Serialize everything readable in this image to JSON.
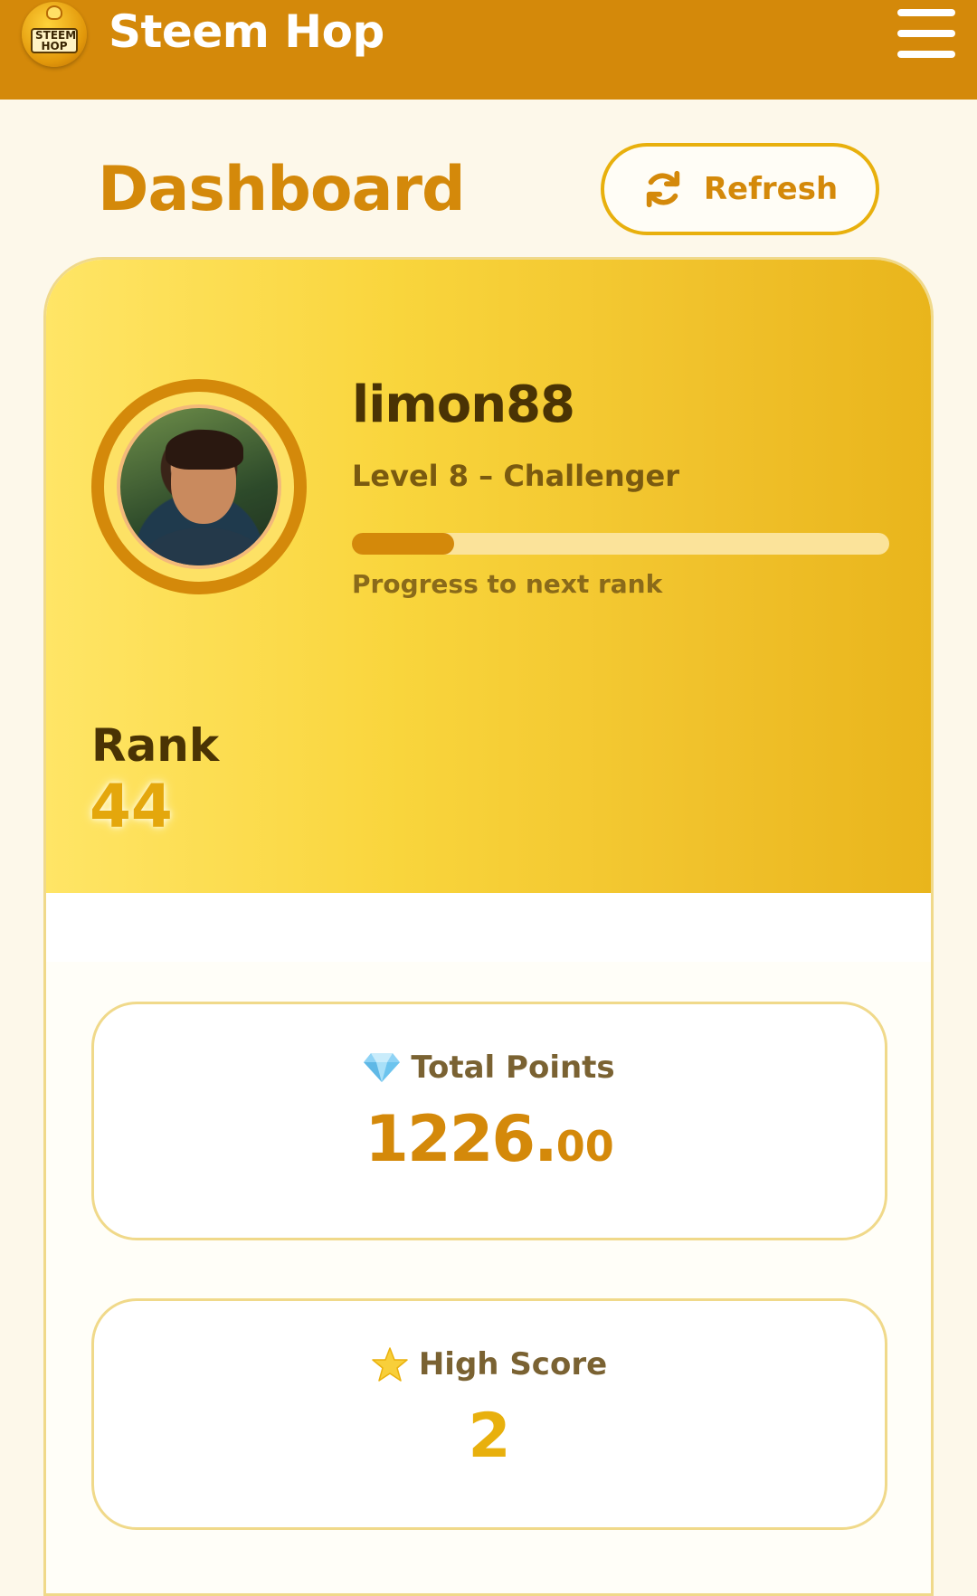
{
  "header": {
    "app_title": "Steem Hop",
    "logo_text": "STEEM HOP",
    "logo_icon": "steem-hop-logo",
    "menu_icon": "hamburger-menu-icon"
  },
  "page": {
    "title": "Dashboard",
    "refresh_label": "Refresh",
    "refresh_icon": "refresh-icon"
  },
  "profile": {
    "username": "limon88",
    "level_text": "Level 8 – Challenger",
    "progress_fraction": 0.19,
    "progress_caption": "Progress to next rank",
    "rank_label": "Rank",
    "rank_value": "44"
  },
  "stats": {
    "total_points": {
      "icon": "diamond-icon",
      "label": "Total Points",
      "value_int": "1226.",
      "value_dec": "00"
    },
    "high_score": {
      "icon": "star-icon",
      "label": "High Score",
      "value": "2"
    }
  },
  "colors": {
    "brand": "#d4890a",
    "header_bg": "#d4890a",
    "card_gradient_start": "#ffe566",
    "card_gradient_end": "#e9b51c",
    "score_color": "#e8b00d"
  }
}
